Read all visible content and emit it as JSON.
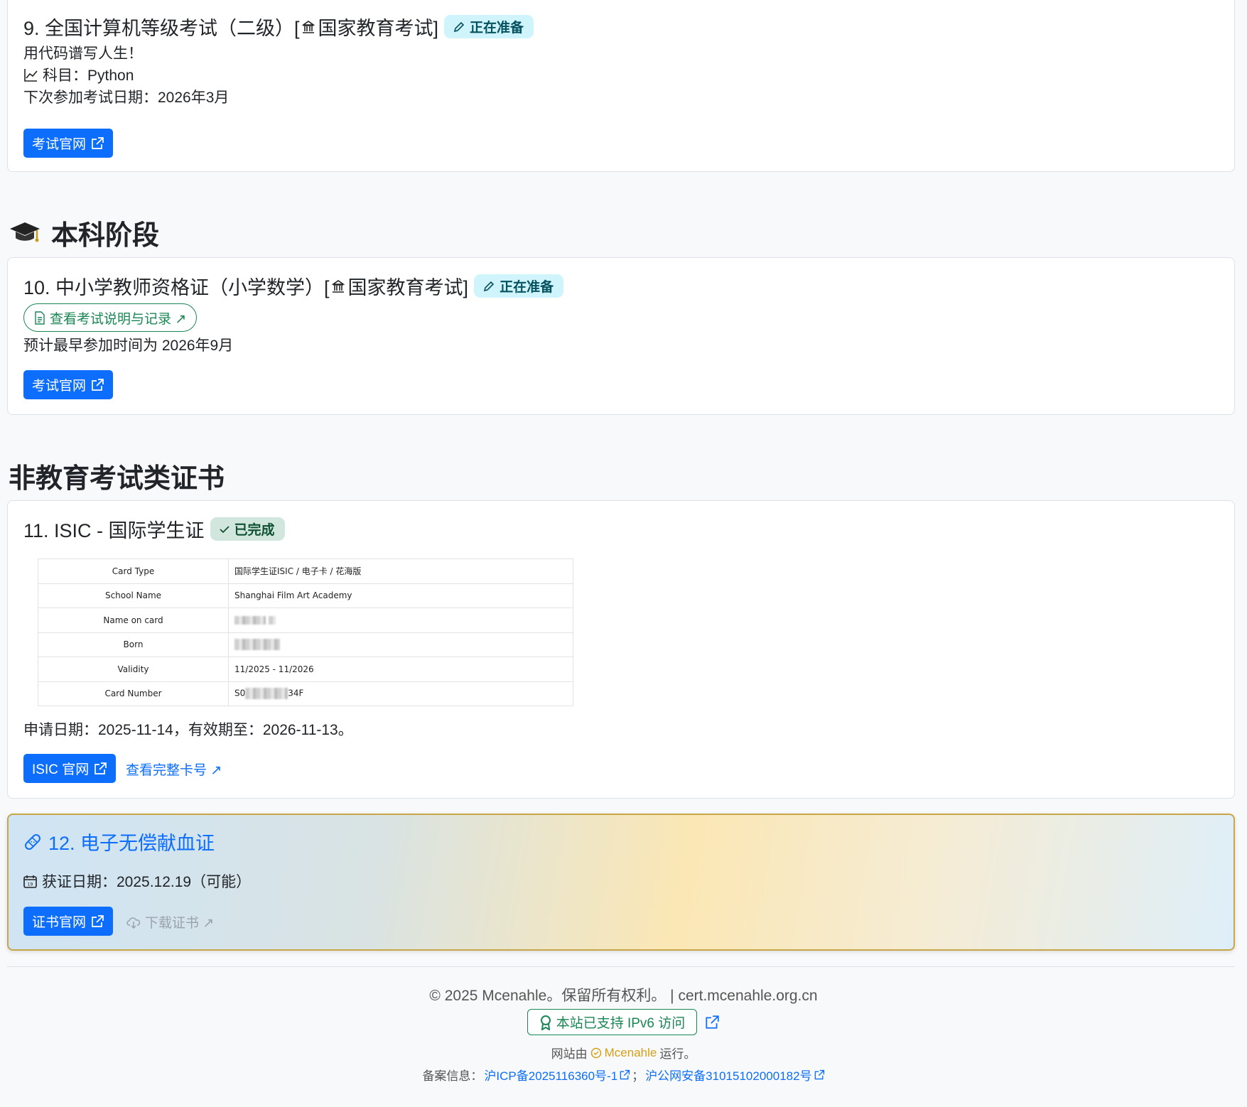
{
  "card9": {
    "title": "9. 全国计算机等级考试（二级）[",
    "org": "国家教育考试]",
    "badge": "正在准备",
    "motto": "用代码谱写人生！",
    "subject": "科目：Python",
    "next_date": "下次参加考试日期：2026年3月",
    "button": "考试官网"
  },
  "section_undergrad": "本科阶段",
  "card10": {
    "title": "10. 中小学教师资格证（小学数学）[",
    "org": "国家教育考试]",
    "badge": "正在准备",
    "record_link": "查看考试说明与记录 ↗",
    "earliest": "预计最早参加时间为 2026年9月",
    "button": "考试官网"
  },
  "section_nonedu": "非教育考试类证书",
  "card11": {
    "title": "11. ISIC - 国际学生证",
    "badge": "已完成",
    "table": [
      {
        "key": "Card Type",
        "value": "国际学生证ISIC / 电子卡 / 花海版"
      },
      {
        "key": "School Name",
        "value": "Shanghai Film Art Academy"
      },
      {
        "key": "Name on card",
        "value": ""
      },
      {
        "key": "Born",
        "value": ""
      },
      {
        "key": "Validity",
        "value": "11/2025 - 11/2026"
      },
      {
        "key": "Card Number",
        "value_prefix": "S0",
        "value_suffix": "34F"
      }
    ],
    "apply_info": "申请日期：2025-11-14，有效期至：2026-11-13。",
    "button": "ISIC 官网",
    "link": "查看完整卡号 ↗"
  },
  "card12": {
    "title": "12. 电子无偿献血证",
    "date": "获证日期：2025.12.19（可能）",
    "button": "证书官网",
    "download": "下载证书 ↗"
  },
  "footer": {
    "copyright": "© 2025 Mcenahle。保留所有权利。 | cert.mcenahle.org.cn",
    "ipv6": "本站已支持 IPv6 访问",
    "run_prefix": "网站由",
    "run_name": "Mcenahle",
    "run_suffix": "运行。",
    "beian_label": "备案信息：",
    "icp": "沪ICP备2025116360号-1",
    "sep": "；",
    "gongan": "沪公网安备31015102000182号"
  },
  "colors": {
    "primary": "#0d6efd",
    "success": "#198754",
    "info_bg": "#cff4fc",
    "success_bg": "#d1e7dd",
    "gold": "#d4a017"
  }
}
